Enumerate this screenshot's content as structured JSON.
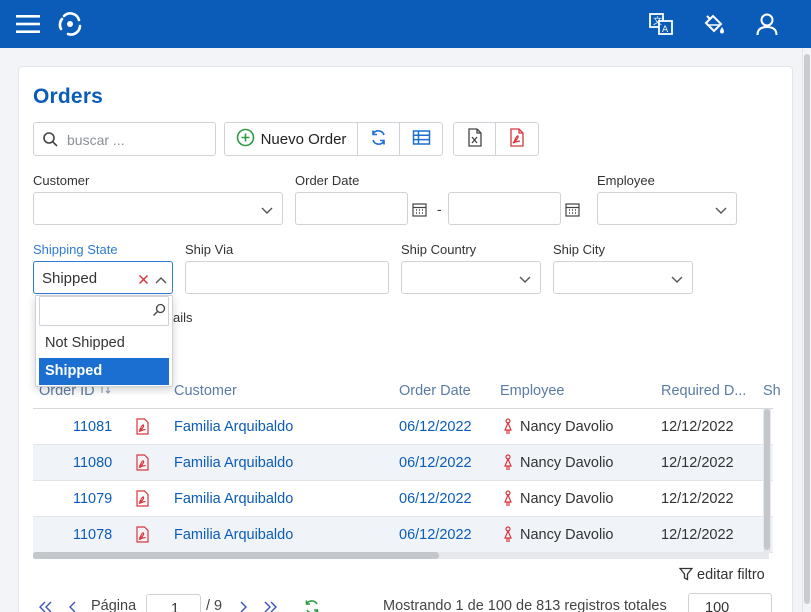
{
  "app": {
    "icons": [
      "menu-icon",
      "logo-icon",
      "translate-icon",
      "paint-bucket-icon",
      "user-icon"
    ]
  },
  "page": {
    "title": "Orders"
  },
  "toolbar": {
    "search_placeholder": "buscar ...",
    "new_label": "Nuevo Order"
  },
  "filters": {
    "customer_label": "Customer",
    "order_date_label": "Order Date",
    "date_separator": "-",
    "employee_label": "Employee",
    "shipping_state_label": "Shipping State",
    "shipping_state_value": "Shipped",
    "ship_via_label": "Ship Via",
    "ship_country_label": "Ship Country",
    "ship_city_label": "Ship City",
    "details_fragment": "ails"
  },
  "dropdown": {
    "options": [
      "Not Shipped",
      "Shipped"
    ],
    "selected": "Shipped"
  },
  "table": {
    "columns": [
      "Order ID",
      "Customer",
      "Order Date",
      "Employee",
      "Required D...",
      "Sh"
    ],
    "rows": [
      {
        "id": "11081",
        "customer": "Familia Arquibaldo",
        "order_date": "06/12/2022",
        "employee": "Nancy Davolio",
        "required": "12/12/2022"
      },
      {
        "id": "11080",
        "customer": "Familia Arquibaldo",
        "order_date": "06/12/2022",
        "employee": "Nancy Davolio",
        "required": "12/12/2022"
      },
      {
        "id": "11079",
        "customer": "Familia Arquibaldo",
        "order_date": "06/12/2022",
        "employee": "Nancy Davolio",
        "required": "12/12/2022"
      },
      {
        "id": "11078",
        "customer": "Familia Arquibaldo",
        "order_date": "06/12/2022",
        "employee": "Nancy Davolio",
        "required": "12/12/2022"
      }
    ]
  },
  "footer": {
    "edit_filter": "editar filtro",
    "page_label": "Página",
    "page_value": "1",
    "page_total": "/ 9",
    "summary": "Mostrando 1 de 100 de 813 registros totales",
    "page_size": "100"
  },
  "colors": {
    "brand": "#0b5cb8",
    "selected": "#1a6fd1",
    "danger": "#d9363e",
    "success": "#2f9b45"
  }
}
